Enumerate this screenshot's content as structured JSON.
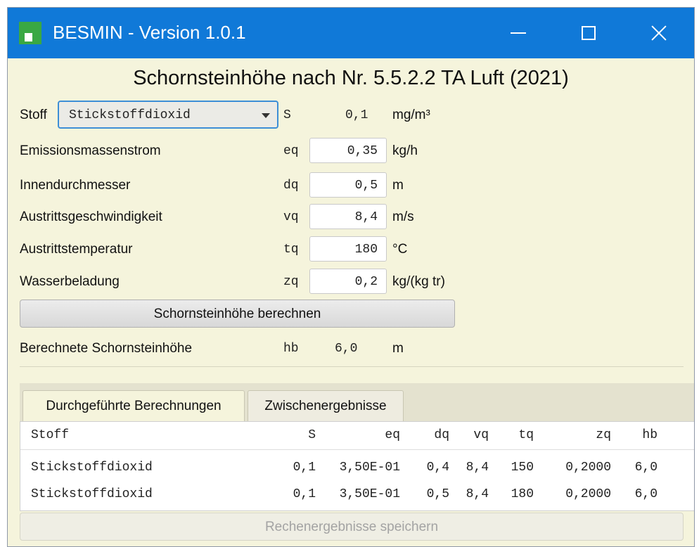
{
  "window": {
    "title": "BESMIN - Version 1.0.1"
  },
  "heading": "Schornsteinhöhe nach Nr. 5.5.2.2 TA Luft (2021)",
  "stoff": {
    "label": "Stoff",
    "selected": "Stickstoffdioxid",
    "symbol": "S",
    "value": "0,1",
    "unit": "mg/m³"
  },
  "fields": [
    {
      "label": "Emissionsmassenstrom",
      "symbol": "eq",
      "value": "0,35",
      "unit": "kg/h"
    },
    {
      "label": "Innendurchmesser",
      "symbol": "dq",
      "value": "0,5",
      "unit": "m"
    },
    {
      "label": "Austrittsgeschwindigkeit",
      "symbol": "vq",
      "value": "8,4",
      "unit": "m/s"
    },
    {
      "label": "Austrittstemperatur",
      "symbol": "tq",
      "value": "180",
      "unit": "°C"
    },
    {
      "label": "Wasserbeladung",
      "symbol": "zq",
      "value": "0,2",
      "unit": "kg/(kg tr)"
    }
  ],
  "calc_button": "Schornsteinhöhe berechnen",
  "result": {
    "label": "Berechnete Schornsteinhöhe",
    "symbol": "hb",
    "value": "6,0",
    "unit": "m"
  },
  "tabs": [
    {
      "label": "Durchgeführte Berechnungen",
      "active": true
    },
    {
      "label": "Zwischenergebnisse",
      "active": false
    }
  ],
  "table": {
    "headers": {
      "stoff": "Stoff",
      "s": "S",
      "eq": "eq",
      "dq": "dq",
      "vq": "vq",
      "tq": "tq",
      "zq": "zq",
      "hb": "hb"
    },
    "rows": [
      {
        "stoff": "Stickstoffdioxid",
        "s": "0,1",
        "eq": "3,50E-01",
        "dq": "0,4",
        "vq": "8,4",
        "tq": "150",
        "zq": "0,2000",
        "hb": "6,0"
      },
      {
        "stoff": "Stickstoffdioxid",
        "s": "0,1",
        "eq": "3,50E-01",
        "dq": "0,5",
        "vq": "8,4",
        "tq": "180",
        "zq": "0,2000",
        "hb": "6,0"
      }
    ]
  },
  "save_button": "Rechenergebnisse speichern",
  "colors": {
    "titlebar": "#1079d8",
    "background": "#f5f4dc",
    "app_icon": "#3aa843",
    "dropdown_focus": "#3d8fd6"
  },
  "icons": {
    "app": "app-icon",
    "minimize": "minimize-icon",
    "maximize": "maximize-icon",
    "close": "close-icon",
    "dropdown": "chevron-down-icon"
  }
}
